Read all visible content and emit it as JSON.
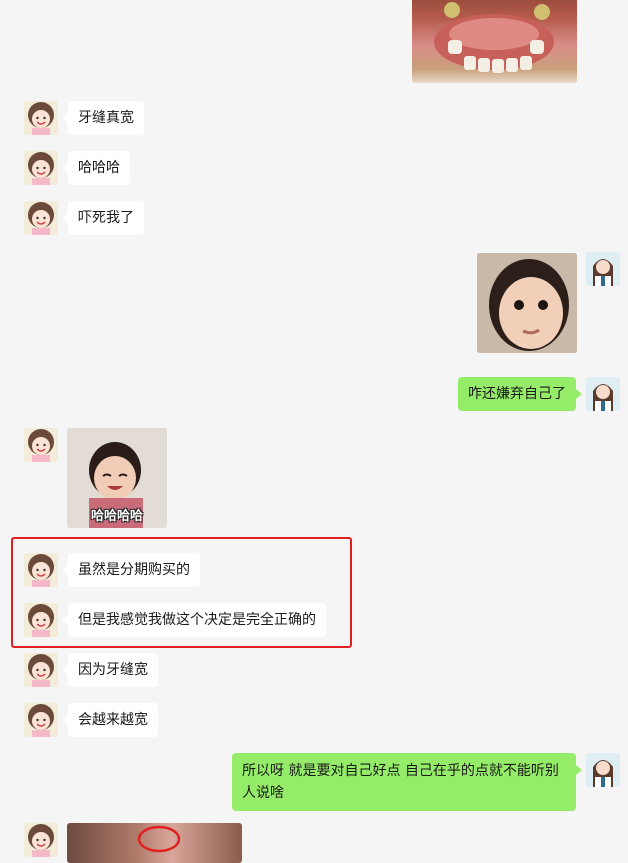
{
  "messages": [
    {
      "id": "m1",
      "side": "in",
      "text": "牙缝真宽"
    },
    {
      "id": "m2",
      "side": "in",
      "text": "哈哈哈"
    },
    {
      "id": "m3",
      "side": "in",
      "text": "吓死我了"
    },
    {
      "id": "m4",
      "side": "out",
      "type": "image",
      "alt": "child-face-photo"
    },
    {
      "id": "m5",
      "side": "out",
      "text": "咋还嫌弃自己了"
    },
    {
      "id": "m6",
      "side": "in",
      "type": "sticker",
      "caption": "哈哈哈哈"
    },
    {
      "id": "m7",
      "side": "in",
      "text": "虽然是分期购买的"
    },
    {
      "id": "m8",
      "side": "in",
      "text": "但是我感觉我做这个决定是完全正确的"
    },
    {
      "id": "m9",
      "side": "in",
      "text": "因为牙缝宽"
    },
    {
      "id": "m10",
      "side": "in",
      "text": "会越来越宽"
    },
    {
      "id": "m11",
      "side": "out",
      "text": "所以呀  就是要对自己好点  自己在乎的点就不能听别人说啥"
    },
    {
      "id": "m12",
      "side": "in",
      "type": "image",
      "alt": "teeth-photo"
    }
  ],
  "colors": {
    "background": "#f5f5f5",
    "incoming_bubble": "#ffffff",
    "outgoing_bubble": "#95ec69",
    "highlight_box": "#e02020"
  }
}
